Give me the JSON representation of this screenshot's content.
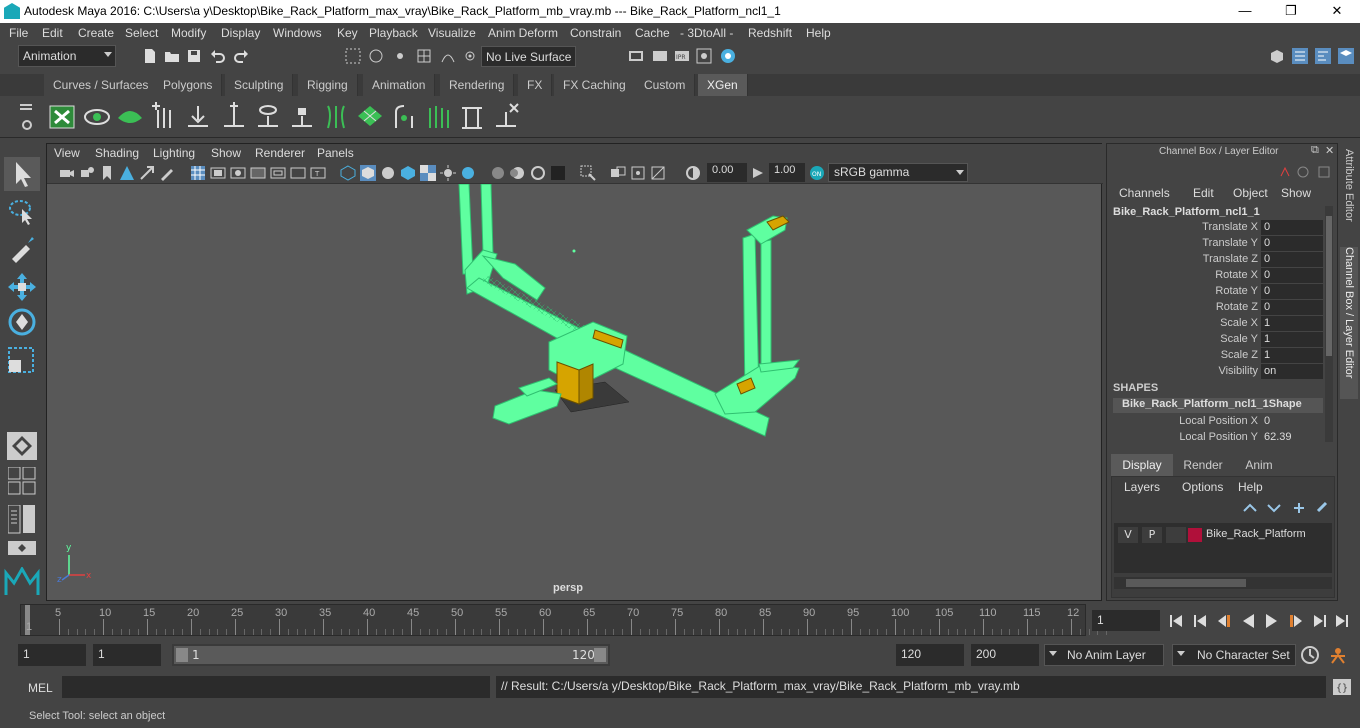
{
  "window": {
    "title": "Autodesk Maya 2016: C:\\Users\\a y\\Desktop\\Bike_Rack_Platform_max_vray\\Bike_Rack_Platform_mb_vray.mb   ---   Bike_Rack_Platform_ncl1_1",
    "minimize": "—",
    "maximize": "❐",
    "close": "✕"
  },
  "menubar": [
    "File",
    "Edit",
    "Create",
    "Select",
    "Modify",
    "Display",
    "Windows",
    "Key",
    "Playback",
    "Visualize",
    "Anim Deform",
    "Constrain",
    "Cache",
    "- 3DtoAll -",
    "Redshift",
    "Help"
  ],
  "toolbar": {
    "mode": "Animation",
    "live_surface": "No Live Surface"
  },
  "shelf_tabs": [
    "Curves / Surfaces",
    "Polygons",
    "Sculpting",
    "Rigging",
    "Animation",
    "Rendering",
    "FX",
    "FX Caching",
    "Custom",
    "XGen"
  ],
  "shelf_active": "XGen",
  "viewport": {
    "menu": [
      "View",
      "Shading",
      "Lighting",
      "Show",
      "Renderer",
      "Panels"
    ],
    "exposure": "0.00",
    "gamma": "1.00",
    "colorspace": "sRGB gamma",
    "camera": "persp",
    "axis_x": "x",
    "axis_y": "y",
    "axis_z": "z"
  },
  "channel_box": {
    "header": "Channel Box / Layer Editor",
    "menu": [
      "Channels",
      "Edit",
      "Object",
      "Show"
    ],
    "object": "Bike_Rack_Platform_ncl1_1",
    "attributes": [
      {
        "name": "Translate X",
        "value": "0"
      },
      {
        "name": "Translate Y",
        "value": "0"
      },
      {
        "name": "Translate Z",
        "value": "0"
      },
      {
        "name": "Rotate X",
        "value": "0"
      },
      {
        "name": "Rotate Y",
        "value": "0"
      },
      {
        "name": "Rotate Z",
        "value": "0"
      },
      {
        "name": "Scale X",
        "value": "1"
      },
      {
        "name": "Scale Y",
        "value": "1"
      },
      {
        "name": "Scale Z",
        "value": "1"
      },
      {
        "name": "Visibility",
        "value": "on"
      }
    ],
    "shapes_label": "SHAPES",
    "shape_name": "Bike_Rack_Platform_ncl1_1Shape",
    "shape_attributes": [
      {
        "name": "Local Position X",
        "value": "0"
      },
      {
        "name": "Local Position Y",
        "value": "62.39"
      }
    ]
  },
  "layer_editor": {
    "tabs": [
      "Display",
      "Render",
      "Anim"
    ],
    "active_tab": "Display",
    "menu": [
      "Layers",
      "Options",
      "Help"
    ],
    "layer": {
      "v": "V",
      "p": "P",
      "name": "Bike_Rack_Platform",
      "color": "#b0103a"
    }
  },
  "side_tabs": [
    "Attribute Editor",
    "Channel Box / Layer Editor"
  ],
  "timeline": {
    "ticks": [
      "5",
      "10",
      "15",
      "20",
      "25",
      "30",
      "35",
      "40",
      "45",
      "50",
      "55",
      "60",
      "65",
      "70",
      "75",
      "80",
      "85",
      "90",
      "95",
      "100",
      "105",
      "110",
      "115",
      "12"
    ],
    "start_label": "1",
    "current_frame": "1"
  },
  "range": {
    "start": "1",
    "anim_start": "1",
    "slider_start": "1",
    "slider_end": "120",
    "end": "120",
    "anim_end": "200",
    "anim_layer": "No Anim Layer",
    "char_set": "No Character Set"
  },
  "mel": {
    "label": "MEL",
    "result": "// Result: C:/Users/a y/Desktop/Bike_Rack_Platform_max_vray/Bike_Rack_Platform_mb_vray.mb"
  },
  "status": "Select Tool: select an object",
  "colors": {
    "wire": "#5fffa0",
    "accent": "#1aa8b8"
  }
}
